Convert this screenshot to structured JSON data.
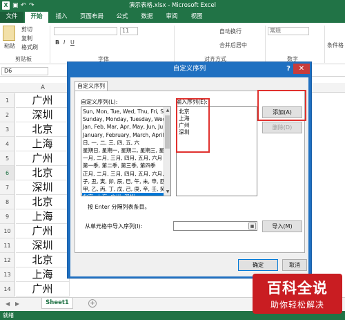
{
  "window": {
    "title": "演示表格.xlsx - Microsoft Excel"
  },
  "ribbon_tabs": [
    "文件",
    "开始",
    "插入",
    "页面布局",
    "公式",
    "数据",
    "审阅",
    "视图"
  ],
  "ribbon": {
    "clipboard": {
      "paste": "粘贴",
      "cut": "剪切",
      "copy": "复制",
      "format_painter": "格式刷",
      "group": "剪贴板"
    },
    "font": {
      "size": "11",
      "group": "字体"
    },
    "alignment": {
      "wrap": "自动换行",
      "merge": "合并后居中",
      "group": "对齐方式"
    },
    "number": {
      "format": "常规",
      "group": "数字"
    },
    "conditional": "条件格"
  },
  "formula_bar": {
    "name_box": "D6"
  },
  "grid": {
    "column_a": "A",
    "rows": [
      {
        "num": "1",
        "a": "广州"
      },
      {
        "num": "2",
        "a": "深圳"
      },
      {
        "num": "3",
        "a": "北京"
      },
      {
        "num": "4",
        "a": "上海"
      },
      {
        "num": "5",
        "a": "广州"
      },
      {
        "num": "6",
        "a": "北京"
      },
      {
        "num": "7",
        "a": "深圳"
      },
      {
        "num": "8",
        "a": "北京"
      },
      {
        "num": "9",
        "a": "上海"
      },
      {
        "num": "10",
        "a": "广州"
      },
      {
        "num": "11",
        "a": "深圳"
      },
      {
        "num": "12",
        "a": "北京"
      },
      {
        "num": "13",
        "a": "上海"
      },
      {
        "num": "14",
        "a": "广州"
      }
    ],
    "selected_row": "6"
  },
  "dialog": {
    "title": "自定义序列",
    "help": "?",
    "close": "✕",
    "tab": "自定义序列",
    "lists_label": "自定义序列(L):",
    "lists": [
      "Sun, Mon, Tue, Wed, Thu, Fri, S",
      "Sunday, Monday, Tuesday, Wed",
      "Jan, Feb, Mar, Apr, May, Jun, Ju",
      "January, February, March, April",
      "日, 一, 二, 三, 四, 五, 六",
      "星期日, 星期一, 星期二, 星期三, 星",
      "一月, 二月, 三月, 四月, 五月, 六月",
      "第一季, 第二季, 第三季, 第四季",
      "正月, 二月, 三月, 四月, 五月, 六月,",
      "子, 丑, 寅, 卯, 辰, 巳, 午, 未, 申, 酉",
      "甲, 乙, 丙, 丁, 戊, 己, 庚, 辛, 壬, 癸",
      "北京, 上海, 广州, 深圳"
    ],
    "selected_list_index": 11,
    "entries_label": "输入序列(E):",
    "entries": [
      "北京",
      "上海",
      "广州",
      "深圳"
    ],
    "add_button": "添加(A)",
    "delete_button": "删除(D)",
    "hint": "按 Enter 分隔列表条目。",
    "import_label": "从单元格中导入序列(I):",
    "import_button": "导入(M)",
    "ok_button": "确定",
    "cancel_button": "取消"
  },
  "sheet_tabs": [
    "Sheet1"
  ],
  "status": "就绪",
  "watermark": {
    "title": "百科全说",
    "subtitle": "助你轻松解决"
  }
}
